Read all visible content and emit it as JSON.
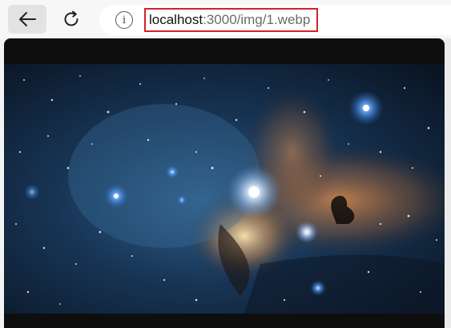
{
  "toolbar": {
    "back_icon": "arrow-left-icon",
    "reload_icon": "reload-icon",
    "info_icon": "info-icon",
    "info_glyph": "i"
  },
  "address": {
    "host": "localhost",
    "path": ":3000/img/1.webp"
  },
  "viewer": {
    "image_subject": "nebula-starfield",
    "background_color": "#0e0e0e"
  }
}
